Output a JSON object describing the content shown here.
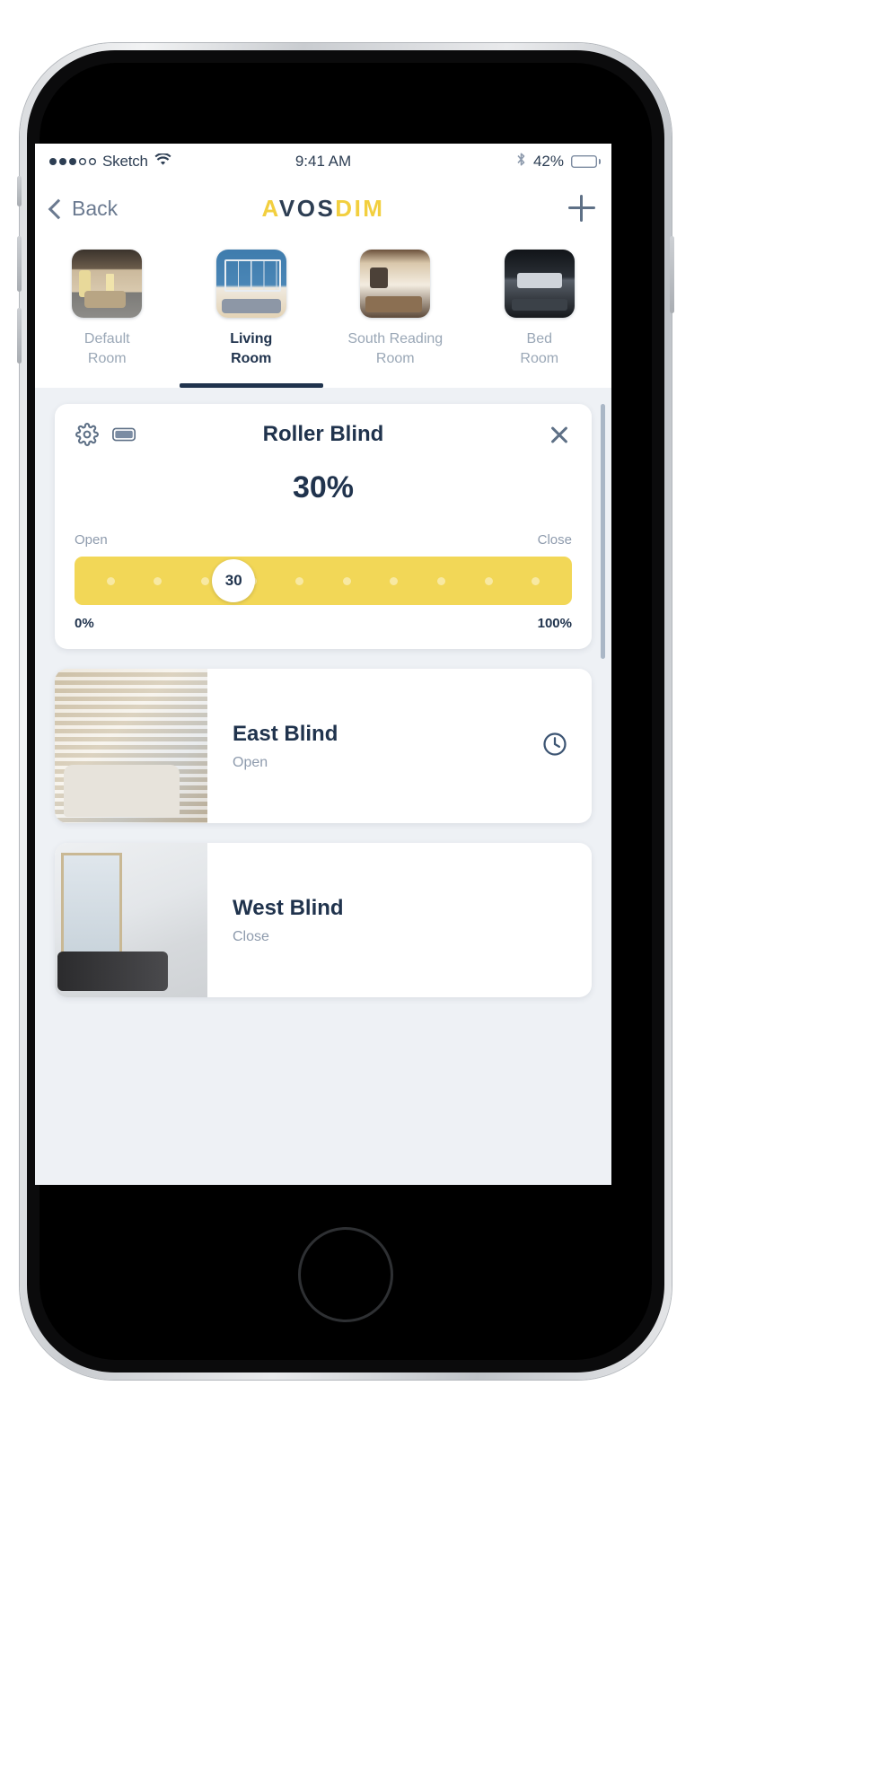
{
  "status_bar": {
    "carrier": "Sketch",
    "signal_dots_filled": 3,
    "signal_dots_total": 5,
    "wifi_icon": "wifi-icon",
    "time": "9:41 AM",
    "bluetooth_icon": "bluetooth-icon",
    "battery_percent": "42%",
    "battery_level": 42
  },
  "navbar": {
    "back_label": "Back",
    "logo_part1": "A",
    "logo_part2": "VOS",
    "logo_part3": "DIM",
    "add_label": "+"
  },
  "rooms": [
    {
      "label_line1": "Default",
      "label_line2": "Room",
      "active": false
    },
    {
      "label_line1": "Living",
      "label_line2": "Room",
      "active": true
    },
    {
      "label_line1": "South Reading",
      "label_line2": "Room",
      "active": false
    },
    {
      "label_line1": "Bed",
      "label_line2": "Room",
      "active": false
    }
  ],
  "roller_blind_card": {
    "settings_icon": "gear-icon",
    "battery_icon": "battery-icon",
    "title": "Roller Blind",
    "close_icon": "close-icon",
    "percent_display": "30%",
    "slider": {
      "left_label": "Open",
      "right_label": "Close",
      "value": 30,
      "value_label": "30",
      "min_label": "0%",
      "max_label": "100%",
      "min": 0,
      "max": 100,
      "tick_count": 10,
      "track_color": "#f2d757"
    }
  },
  "devices": [
    {
      "name": "East Blind",
      "state": "Open",
      "action_icon": "clock-icon",
      "image": "east-blind-photo"
    },
    {
      "name": "West Blind",
      "state": "Close",
      "action_icon": "",
      "image": "west-blind-photo"
    }
  ],
  "colors": {
    "navy": "#20334d",
    "yellow": "#f2d757",
    "muted": "#8e9bad",
    "background": "#eef1f5"
  }
}
